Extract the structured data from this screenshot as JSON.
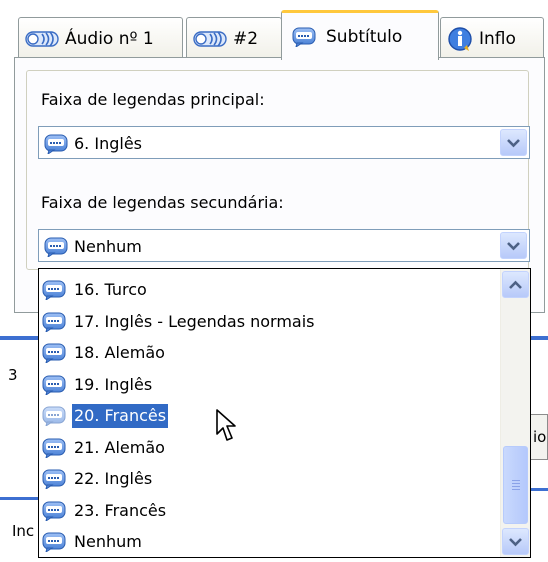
{
  "tabs": [
    {
      "label": "Áudio nº 1"
    },
    {
      "label": "#2"
    },
    {
      "label": "Subtítulo"
    },
    {
      "label": "Inflo"
    }
  ],
  "primary_subtitle": {
    "label": "Faixa de legendas principal:",
    "value": "6. Inglês"
  },
  "secondary_subtitle": {
    "label": "Faixa de legendas secundária:",
    "value": "Nenhum"
  },
  "dropdown": {
    "items": [
      {
        "label": "16. Turco"
      },
      {
        "label": "17. Inglês - Legendas normais"
      },
      {
        "label": "18. Alemão"
      },
      {
        "label": "19. Inglês"
      },
      {
        "label": "20. Francês"
      },
      {
        "label": "21. Alemão"
      },
      {
        "label": "22. Inglês"
      },
      {
        "label": "23. Francês"
      },
      {
        "label": "Nenhum"
      }
    ],
    "selected": "20. Francês",
    "scroll_fraction": 0.85
  },
  "background_window": {
    "fragments": [
      "3",
      "io",
      "Inc"
    ]
  },
  "icons": {
    "audio": "speaker-icon",
    "subtitle": "speech-bubble-icon",
    "info": "info-icon"
  },
  "colors": {
    "selection": "#316ac5",
    "active_tab_accent": "#ffc83c",
    "combo_border": "#7f9db9"
  }
}
